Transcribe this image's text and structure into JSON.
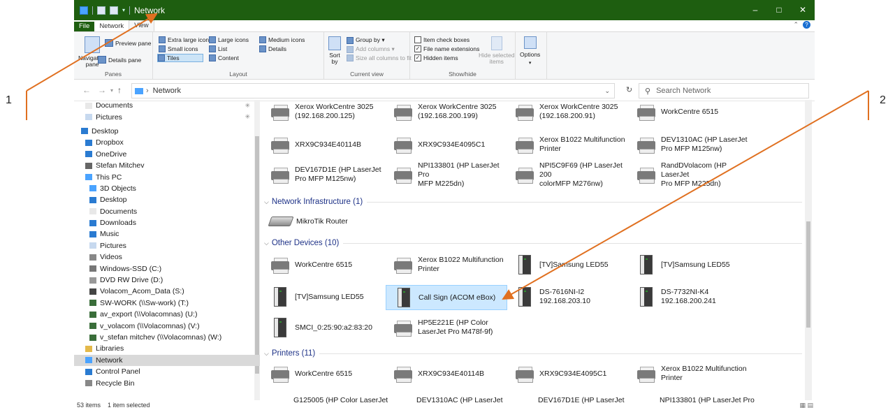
{
  "window": {
    "title": "Network",
    "minimize": "‒",
    "maximize": "□",
    "close": "✕"
  },
  "ribbon_tabs": [
    "File",
    "Network",
    "View"
  ],
  "ribbon": {
    "panes": {
      "nav_label": "Navigation\npane",
      "preview": "Preview pane",
      "details": "Details pane",
      "group": "Panes"
    },
    "layout": {
      "items": [
        "Extra large icons",
        "Large icons",
        "Medium icons",
        "Small icons",
        "List",
        "Details",
        "Tiles",
        "Content"
      ],
      "group": "Layout"
    },
    "current_view": {
      "sort": "Sort\nby",
      "group_by": "Group by ▾",
      "add_columns": "Add columns ▾",
      "size_all": "Size all columns to fit",
      "group": "Current view"
    },
    "show_hide": {
      "item_check": "Item check boxes",
      "file_ext": "File name extensions",
      "hidden": "Hidden items",
      "hide_selected": "Hide selected\nitems",
      "group": "Show/hide"
    },
    "options": {
      "label": "Options"
    }
  },
  "address": {
    "crumb": "Network",
    "search_placeholder": "Search Network"
  },
  "sidebar": [
    {
      "label": "Documents",
      "pinned": true
    },
    {
      "label": "Pictures",
      "pinned": true
    },
    {
      "label": "Desktop"
    },
    {
      "label": "Dropbox"
    },
    {
      "label": "OneDrive"
    },
    {
      "label": "Stefan Mitchev"
    },
    {
      "label": "This PC"
    },
    {
      "label": "3D Objects"
    },
    {
      "label": "Desktop"
    },
    {
      "label": "Documents"
    },
    {
      "label": "Downloads"
    },
    {
      "label": "Music"
    },
    {
      "label": "Pictures"
    },
    {
      "label": "Videos"
    },
    {
      "label": "Windows-SSD (C:)"
    },
    {
      "label": "DVD RW Drive (D:)"
    },
    {
      "label": "Volacom_Acom_Data (S:)"
    },
    {
      "label": "SW-WORK (\\\\Sw-work) (T:)"
    },
    {
      "label": "av_export (\\\\Volacomnas) (U:)"
    },
    {
      "label": "v_volacom (\\\\Volacomnas) (V:)"
    },
    {
      "label": "v_stefan mitchev (\\\\Volacomnas) (W:)"
    },
    {
      "label": "Libraries"
    },
    {
      "label": "Network",
      "selected": true
    },
    {
      "label": "Control Panel"
    },
    {
      "label": "Recycle Bin"
    }
  ],
  "content": {
    "top_items": [
      "Xerox WorkCentre 3025\n(192.168.200.125)",
      "Xerox WorkCentre 3025\n(192.168.200.199)",
      "Xerox WorkCentre 3025\n(192.168.200.91)",
      "WorkCentre 6515",
      "XRX9C934E40114B",
      "XRX9C934E4095C1",
      "Xerox B1022 Multifunction\nPrinter",
      "DEV1310AC (HP LaserJet\nPro MFP M125nw)",
      "DEV167D1E (HP LaserJet\nPro MFP M125nw)",
      "NPI133801 (HP LaserJet Pro\nMFP M225dn)",
      "NPI5C9F69 (HP LaserJet 200\ncolorMFP M276nw)",
      "RandDVolacom (HP LaserJet\nPro MFP M225dn)"
    ],
    "section_infra": "Network Infrastructure (1)",
    "infra_items": [
      "MikroTik Router"
    ],
    "section_other": "Other Devices (10)",
    "other_items": [
      {
        "label": "WorkCentre 6515",
        "kind": "printer"
      },
      {
        "label": "Xerox B1022 Multifunction\nPrinter",
        "kind": "printer"
      },
      {
        "label": "[TV]Samsung LED55",
        "kind": "device"
      },
      {
        "label": "[TV]Samsung LED55",
        "kind": "device"
      },
      {
        "label": "[TV]Samsung LED55",
        "kind": "device"
      },
      {
        "label": "Call Sign (ACOM eBox)",
        "kind": "device",
        "selected": true
      },
      {
        "label": "DS-7616NI-I2\n192.168.203.10",
        "kind": "device"
      },
      {
        "label": "DS-7732NI-K4\n192.168.200.241",
        "kind": "device"
      },
      {
        "label": "SMCI_0:25:90:a2:83:20",
        "kind": "device"
      },
      {
        "label": "HP5E221E (HP Color\nLaserJet Pro M478f-9f)",
        "kind": "printer"
      }
    ],
    "section_printers": "Printers (11)",
    "printer_items": [
      "WorkCentre 6515",
      "XRX9C934E40114B",
      "XRX9C934E4095C1",
      "Xerox B1022 Multifunction\nPrinter"
    ],
    "partial_row": [
      "G125005 (HP Color LaserJet",
      "DEV1310AC (HP LaserJet",
      "DEV167D1E (HP LaserJet",
      "NPI133801 (HP LaserJet Pro"
    ]
  },
  "status": {
    "count": "53 items",
    "selected": "1 item selected"
  },
  "callouts": {
    "left": "1",
    "right": "2"
  },
  "colors": {
    "titlebar": "#1e5e10",
    "arrow": "#e07020",
    "selection": "#cce8ff"
  }
}
